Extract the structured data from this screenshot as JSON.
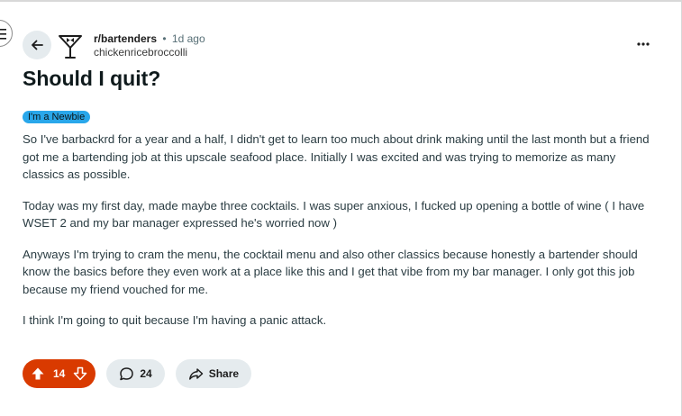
{
  "post": {
    "subreddit": "r/bartenders",
    "separator": "•",
    "time_ago": "1d ago",
    "author": "chickenricebroccolli",
    "title": "Should I quit?",
    "flair": "I'm a Newbie",
    "paragraphs": [
      "So I've barbackrd for a year and a half, I didn't get to learn too much about drink making until the last month but a friend got me a bartending job at this upscale seafood place. Initially I was excited and was trying to memorize as many classics as possible.",
      "Today was my first day, made maybe three cocktails. I was super anxious, I fucked up opening a bottle of wine ( I have WSET 2 and my bar manager expressed he's worried now )",
      "Anyways I'm trying to cram the menu, the cocktail menu and also other classics because honestly a bartender should know the basics before they even work at a place like this and I get that vibe from my bar manager. I only got this job because my friend vouched for me.",
      "I think I'm going to quit because I'm having a panic attack."
    ]
  },
  "actions": {
    "votes": "14",
    "comments": "24",
    "share_label": "Share"
  },
  "colors": {
    "upvoted": "#d93a00",
    "flair_bg": "#29a7ea",
    "pill_bg": "#e5ebee"
  },
  "icons": {
    "menu": "menu-icon",
    "back": "back-arrow-icon",
    "subreddit": "cocktail-waiter-icon",
    "more": "more-options-icon",
    "upvote": "upvote-icon",
    "downvote": "downvote-icon",
    "comment": "comment-icon",
    "share": "share-icon"
  }
}
